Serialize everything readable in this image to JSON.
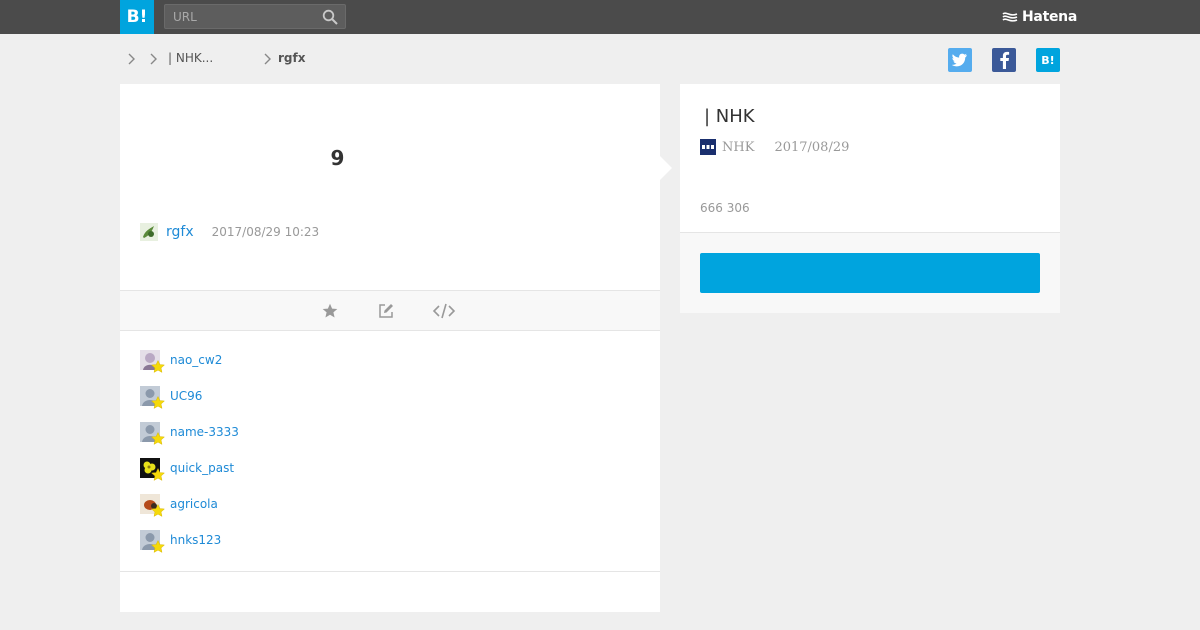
{
  "header": {
    "logo_label": "B!",
    "search": {
      "placeholder": "URL",
      "value": ""
    },
    "brand": "Hatena"
  },
  "breadcrumb": {
    "items": [
      "",
      "| NHK...",
      "rgfx"
    ]
  },
  "share": {
    "twitter_icon": "twitter-icon",
    "facebook_icon": "facebook-icon",
    "hatena_label": "B!"
  },
  "bookmark": {
    "comment": "9",
    "author": "rgfx",
    "timestamp": "2017/08/29 10:23",
    "actions": [
      "star-icon",
      "edit-icon",
      "embed-code-icon"
    ]
  },
  "stars": {
    "users": [
      "nao_cw2",
      "UC96",
      "name-3333",
      "quick_past",
      "agricola",
      "hnks123"
    ]
  },
  "entry": {
    "title": "| NHK",
    "source": "NHK",
    "date": "2017/08/29",
    "users": "666 306",
    "button_label": ""
  },
  "colors": {
    "hatena_blue": "#00a4de",
    "topbar": "#4b4b4b",
    "link": "#1e8ad6",
    "star": "#f5d90a"
  }
}
